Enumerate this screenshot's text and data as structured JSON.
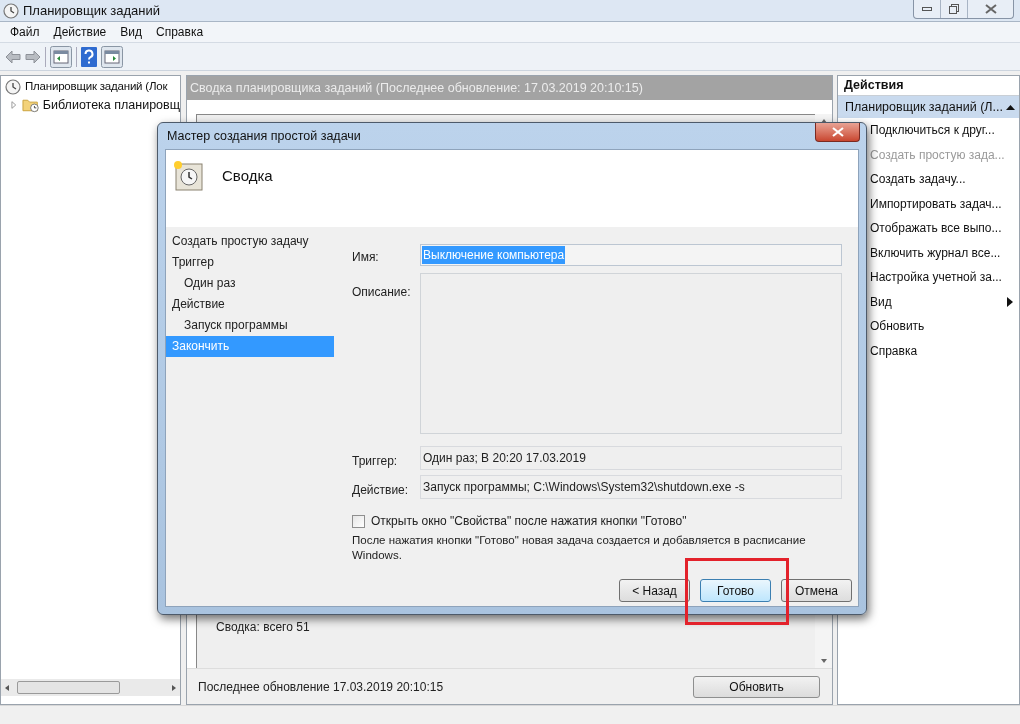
{
  "window": {
    "title": "Планировщик заданий"
  },
  "menu": [
    "Файл",
    "Действие",
    "Вид",
    "Справка"
  ],
  "tree": [
    {
      "label": "Планировщик заданий (Лок",
      "children": [
        {
          "label": "Библиотека планировщ",
          "expanded": false
        }
      ]
    }
  ],
  "summary": {
    "header": "Сводка планировщика заданий (Последнее обновление: 17.03.2019 20:10:15)",
    "total": "Сводка: всего 51",
    "last_update": "Последнее обновление 17.03.2019 20:10:15",
    "refresh_button": "Обновить"
  },
  "actions": {
    "title": "Действия",
    "group": {
      "label": "Планировщик заданий (Л...",
      "expanded": true
    },
    "items": [
      {
        "label": "Подключиться к друг...",
        "kind": "item",
        "disabled": false
      },
      {
        "label": "Создать простую зада...",
        "kind": "item",
        "disabled": true
      },
      {
        "label": "Создать задачу...",
        "kind": "item",
        "disabled": false
      },
      {
        "label": "Импортировать задач...",
        "kind": "item",
        "disabled": false
      },
      {
        "label": "Отображать все выпо...",
        "kind": "item",
        "disabled": false
      },
      {
        "label": "Включить журнал все...",
        "kind": "item",
        "disabled": false
      },
      {
        "label": "Настройка учетной за...",
        "kind": "item",
        "disabled": false
      },
      {
        "label": "Вид",
        "kind": "submenu",
        "disabled": false
      },
      {
        "label": "Обновить",
        "kind": "item",
        "disabled": false
      },
      {
        "label": "Справка",
        "kind": "item",
        "disabled": false
      }
    ]
  },
  "dialog": {
    "title": "Мастер создания простой задачи",
    "heading": "Сводка",
    "steps": [
      {
        "label": "Создать простую задачу",
        "selected": false
      },
      {
        "label": "Триггер",
        "selected": false,
        "children": [
          {
            "label": "Один раз",
            "selected": false
          }
        ]
      },
      {
        "label": "Действие",
        "selected": false,
        "children": [
          {
            "label": "Запуск программы",
            "selected": false
          }
        ]
      },
      {
        "label": "Закончить",
        "selected": true
      }
    ],
    "fields": [
      {
        "label": "Имя:",
        "kind": "text",
        "value": "Выключение компьютера",
        "text_selected": true
      },
      {
        "label": "Описание:",
        "kind": "multiline"
      },
      {
        "label": "Триггер:",
        "kind": "readonly",
        "value": "Один раз; В 20:20 17.03.2019"
      },
      {
        "label": "Действие:",
        "kind": "readonly",
        "value": "Запуск программы; C:\\Windows\\System32\\shutdown.exe -s"
      }
    ],
    "checkbox": {
      "label": "Открыть окно \"Свойства\" после нажатия кнопки \"Готово\"",
      "checked": false
    },
    "note": "После нажатия кнопки \"Готово\" новая задача создается и добавляется в расписание Windows.",
    "buttons": [
      {
        "label": "< Назад",
        "default": false
      },
      {
        "label": "Готово",
        "default": true
      },
      {
        "label": "Отмена",
        "default": false
      }
    ]
  }
}
